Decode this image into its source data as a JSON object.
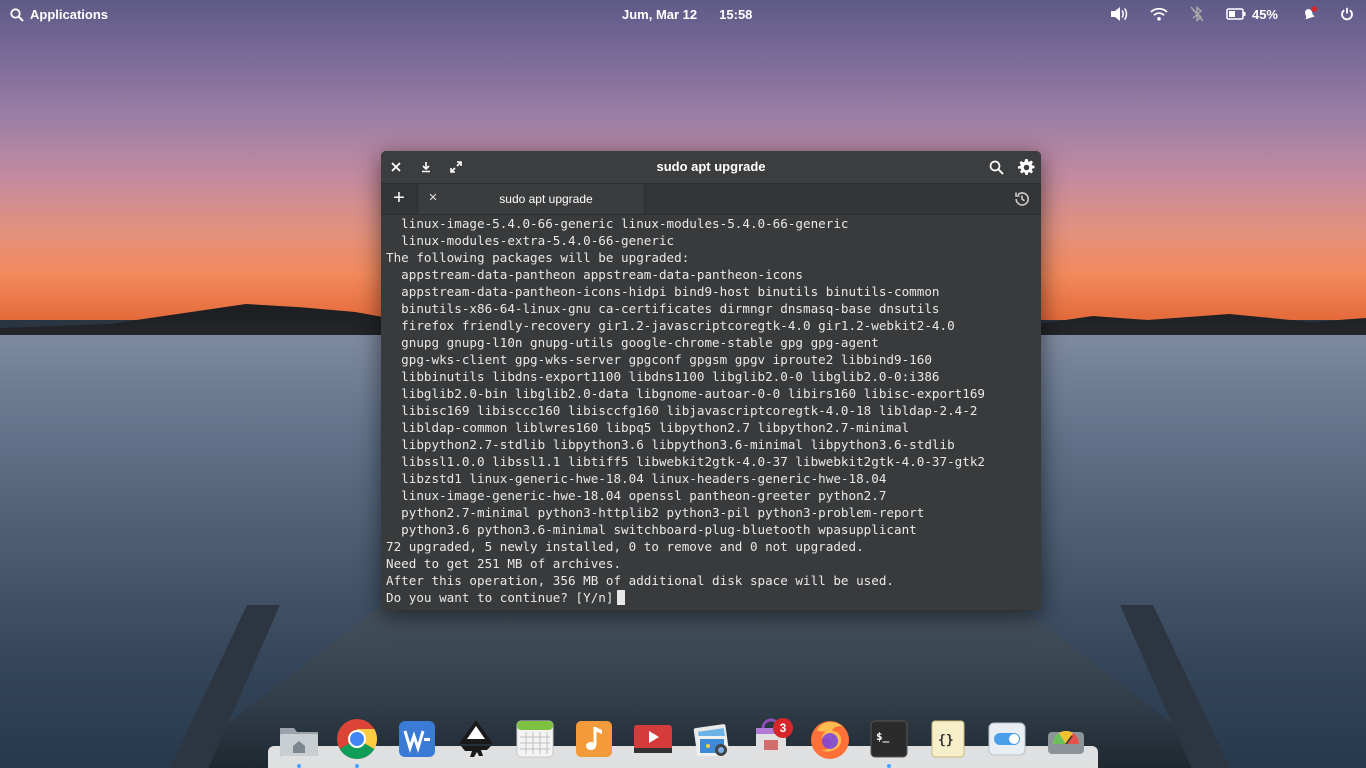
{
  "top_panel": {
    "applications_label": "Applications",
    "date": "Jum, Mar 12",
    "time": "15:58",
    "battery_percent": "45%"
  },
  "terminal": {
    "title": "sudo apt upgrade",
    "tab_label": "sudo apt upgrade",
    "output_lines": [
      "  linux-image-5.4.0-66-generic linux-modules-5.4.0-66-generic",
      "  linux-modules-extra-5.4.0-66-generic",
      "The following packages will be upgraded:",
      "  appstream-data-pantheon appstream-data-pantheon-icons",
      "  appstream-data-pantheon-icons-hidpi bind9-host binutils binutils-common",
      "  binutils-x86-64-linux-gnu ca-certificates dirmngr dnsmasq-base dnsutils",
      "  firefox friendly-recovery gir1.2-javascriptcoregtk-4.0 gir1.2-webkit2-4.0",
      "  gnupg gnupg-l10n gnupg-utils google-chrome-stable gpg gpg-agent",
      "  gpg-wks-client gpg-wks-server gpgconf gpgsm gpgv iproute2 libbind9-160",
      "  libbinutils libdns-export1100 libdns1100 libglib2.0-0 libglib2.0-0:i386",
      "  libglib2.0-bin libglib2.0-data libgnome-autoar-0-0 libirs160 libisc-export169",
      "  libisc169 libisccc160 libisccfg160 libjavascriptcoregtk-4.0-18 libldap-2.4-2",
      "  libldap-common liblwres160 libpq5 libpython2.7 libpython2.7-minimal",
      "  libpython2.7-stdlib libpython3.6 libpython3.6-minimal libpython3.6-stdlib",
      "  libssl1.0.0 libssl1.1 libtiff5 libwebkit2gtk-4.0-37 libwebkit2gtk-4.0-37-gtk2",
      "  libzstd1 linux-generic-hwe-18.04 linux-headers-generic-hwe-18.04",
      "  linux-image-generic-hwe-18.04 openssl pantheon-greeter python2.7",
      "  python2.7-minimal python3-httplib2 python3-pil python3-problem-report",
      "  python3.6 python3.6-minimal switchboard-plug-bluetooth wpasupplicant",
      "72 upgraded, 5 newly installed, 0 to remove and 0 not upgraded.",
      "Need to get 251 MB of archives.",
      "After this operation, 356 MB of additional disk space will be used."
    ],
    "prompt": "Do you want to continue? [Y/n]"
  },
  "dock": {
    "items": [
      "files-icon",
      "chrome-icon",
      "wps-writer-icon",
      "inkscape-icon",
      "calendar-icon",
      "music-icon",
      "videos-icon",
      "photos-icon",
      "appcenter-icon",
      "firefox-icon",
      "terminal-icon",
      "code-icon",
      "system-settings-icon",
      "disk-usage-icon"
    ],
    "appcenter_badge": "3"
  },
  "colors": {
    "terminal_bg": "#383a3c",
    "accent": "#4aa3ff",
    "badge": "#d7262a"
  }
}
